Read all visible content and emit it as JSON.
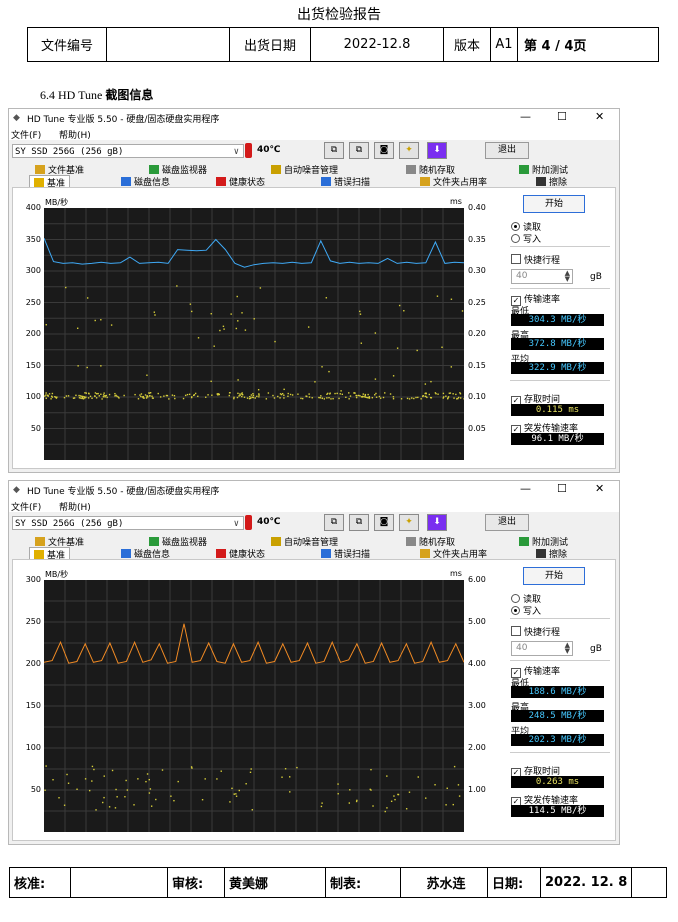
{
  "doc_title": "出货检验报告",
  "header": {
    "file_no_label": "文件编号",
    "file_no_value": "",
    "ship_date_label": "出货日期",
    "ship_date_value": "2022-12.8",
    "version_label": "版本",
    "version_value": "A1",
    "page_label": "第 4 / 4页"
  },
  "section_title_prefix": "6.4 HD Tune",
  "section_title_suffix": "截图信息",
  "windows": [
    {
      "title": "HD Tune 专业版 5.50 - 硬盘/固态硬盘实用程序",
      "menu": [
        "文件(F)",
        "帮助(H)"
      ],
      "drive": "SY SSD 256G (256 gB)",
      "temp": "40℃",
      "exit_label": "退出",
      "tabs_row1": [
        "文件基准",
        "磁盘监视器",
        "自动噪音管理",
        "随机存取",
        "附加测试"
      ],
      "tabs_row2": [
        "基准",
        "磁盘信息",
        "健康状态",
        "错误扫描",
        "文件夹占用率",
        "擦除"
      ],
      "start_label": "开始",
      "read_label": "读取",
      "write_label": "写入",
      "mode": "read",
      "short_stroke_label": "快捷行程",
      "short_stroke_value": "40",
      "gb_unit": "gB",
      "transfer_label": "传输速率",
      "min_label": "最低",
      "min_value": "304.3 MB/秒",
      "max_label": "最高",
      "max_value": "372.8 MB/秒",
      "avg_label": "平均",
      "avg_value": "322.9 MB/秒",
      "access_label": "存取时间",
      "access_value": "0.115 ms",
      "burst_label": "突发传输速率",
      "burst_value": "96.1 MB/秒",
      "left_unit": "MB/秒",
      "right_unit": "ms",
      "yticks": [
        "400",
        "350",
        "300",
        "250",
        "200",
        "150",
        "100",
        "50"
      ],
      "rticks": [
        "0.40",
        "0.35",
        "0.30",
        "0.25",
        "0.20",
        "0.15",
        "0.10",
        "0.05"
      ]
    },
    {
      "title": "HD Tune 专业版 5.50 - 硬盘/固态硬盘实用程序",
      "menu": [
        "文件(F)",
        "帮助(H)"
      ],
      "drive": "SY SSD 256G (256 gB)",
      "temp": "40℃",
      "exit_label": "退出",
      "tabs_row1": [
        "文件基准",
        "磁盘监视器",
        "自动噪音管理",
        "随机存取",
        "附加测试"
      ],
      "tabs_row2": [
        "基准",
        "磁盘信息",
        "健康状态",
        "错误扫描",
        "文件夹占用率",
        "擦除"
      ],
      "start_label": "开始",
      "read_label": "读取",
      "write_label": "写入",
      "mode": "write",
      "short_stroke_label": "快捷行程",
      "short_stroke_value": "40",
      "gb_unit": "gB",
      "transfer_label": "传输速率",
      "min_label": "最低",
      "min_value": "188.6 MB/秒",
      "max_label": "最高",
      "max_value": "248.5 MB/秒",
      "avg_label": "平均",
      "avg_value": "202.3 MB/秒",
      "access_label": "存取时间",
      "access_value": "0.263 ms",
      "burst_label": "突发传输速率",
      "burst_value": "114.5 MB/秒",
      "left_unit": "MB/秒",
      "right_unit": "ms",
      "yticks": [
        "300",
        "250",
        "200",
        "150",
        "100",
        "50"
      ],
      "rticks": [
        "6.00",
        "5.00",
        "4.00",
        "3.00",
        "2.00",
        "1.00"
      ]
    }
  ],
  "chart_data": [
    {
      "type": "line",
      "title": "",
      "series": [
        {
          "name": "",
          "color": "#3fa9f5",
          "values": [
            352,
            315,
            312,
            313,
            311,
            312,
            314,
            312,
            313,
            322,
            312,
            313,
            314,
            312,
            334,
            333,
            332,
            333,
            350,
            334,
            312,
            306,
            310,
            312,
            313,
            312,
            314,
            312,
            313,
            348,
            316,
            312,
            314,
            312,
            313,
            312,
            320,
            312,
            314,
            312,
            313,
            346,
            312,
            314,
            313
          ]
        },
        {
          "name": "",
          "color": "#d8cf3a",
          "type": "scatter",
          "values_ms": "access-time points mostly near 0.10 ms with scattered points 0.11–0.28 ms"
        }
      ],
      "ylim_left": [
        0,
        400
      ],
      "ylim_right": [
        0,
        0.4
      ],
      "colors": {
        "line": "#3fa9f5",
        "points": "#d8cf3a",
        "background": "#1a1a1a"
      }
    },
    {
      "type": "line",
      "title": "",
      "series": [
        {
          "name": "",
          "color": "#f08a24",
          "values": [
            202,
            204,
            226,
            201,
            203,
            224,
            202,
            204,
            225,
            201,
            203,
            226,
            202,
            205,
            224,
            201,
            203,
            248,
            202,
            204,
            225,
            203,
            201,
            224,
            202,
            204,
            226,
            201,
            203,
            224,
            202,
            204,
            225,
            201,
            203,
            226,
            202,
            205,
            224,
            201,
            203,
            225,
            202,
            204,
            224,
            201,
            203,
            226,
            202,
            204,
            224,
            202
          ]
        },
        {
          "name": "",
          "color": "#d8cf3a",
          "type": "scatter",
          "values_ms": "access-time points mostly 0.5–1.5 ms"
        }
      ],
      "ylim_left": [
        0,
        300
      ],
      "ylim_right": [
        0,
        6.0
      ],
      "colors": {
        "line": "#f08a24",
        "points": "#d8cf3a",
        "background": "#1a1a1a"
      }
    }
  ],
  "footer": {
    "approve_label": "核准:",
    "approve_value": "",
    "review_label": "审核:",
    "review_value": "黄美娜",
    "made_label": "制表:",
    "made_value": "苏水连",
    "date_label": "日期:",
    "date_value": "2022. 12. 8"
  }
}
